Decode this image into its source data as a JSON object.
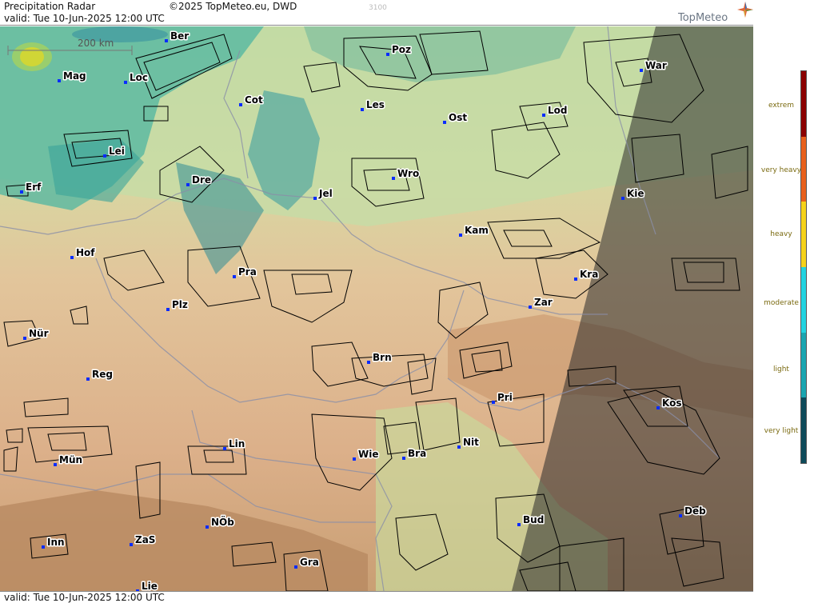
{
  "header": {
    "title": "Precipitation Radar",
    "copyright": "©2025 TopMeteo.eu, DWD",
    "code": "3100",
    "valid": "valid:  Tue  10-Jun-2025 12:00 UTC",
    "brand": "TopMeteo"
  },
  "footer": {
    "valid": "valid:  Tue  10-Jun-2025 12:00 UTC"
  },
  "scale_bar": {
    "label": "200 km"
  },
  "legend": {
    "levels": [
      {
        "label": "extrem",
        "color": "#8b0000"
      },
      {
        "label": "very heavy",
        "color": "#e8601c"
      },
      {
        "label": "heavy",
        "color": "#f6d21a"
      },
      {
        "label": "moderate",
        "color": "#22d3e0"
      },
      {
        "label": "light",
        "color": "#1aa5b0"
      },
      {
        "label": "very light",
        "color": "#0d4a5a"
      }
    ]
  },
  "cities": [
    {
      "name": "Ber"
    },
    {
      "name": "Poz"
    },
    {
      "name": "War"
    },
    {
      "name": "Mag"
    },
    {
      "name": "Loc"
    },
    {
      "name": "Cot"
    },
    {
      "name": "Les"
    },
    {
      "name": "Lod"
    },
    {
      "name": "Ost"
    },
    {
      "name": "Lei"
    },
    {
      "name": "Dre"
    },
    {
      "name": "Wro"
    },
    {
      "name": "Erf"
    },
    {
      "name": "Jel"
    },
    {
      "name": "Kie"
    },
    {
      "name": "Kam"
    },
    {
      "name": "Hof"
    },
    {
      "name": "Pra"
    },
    {
      "name": "Kra"
    },
    {
      "name": "Plz"
    },
    {
      "name": "Zar"
    },
    {
      "name": "Nür"
    },
    {
      "name": "Brn"
    },
    {
      "name": "Reg"
    },
    {
      "name": "Pri"
    },
    {
      "name": "Kos"
    },
    {
      "name": "Lin"
    },
    {
      "name": "Nit"
    },
    {
      "name": "Mün"
    },
    {
      "name": "Wie"
    },
    {
      "name": "Bra"
    },
    {
      "name": "Deb"
    },
    {
      "name": "Bud"
    },
    {
      "name": "NÖb"
    },
    {
      "name": "Inn"
    },
    {
      "name": "ZaS"
    },
    {
      "name": "Gra"
    },
    {
      "name": "Lie"
    }
  ]
}
